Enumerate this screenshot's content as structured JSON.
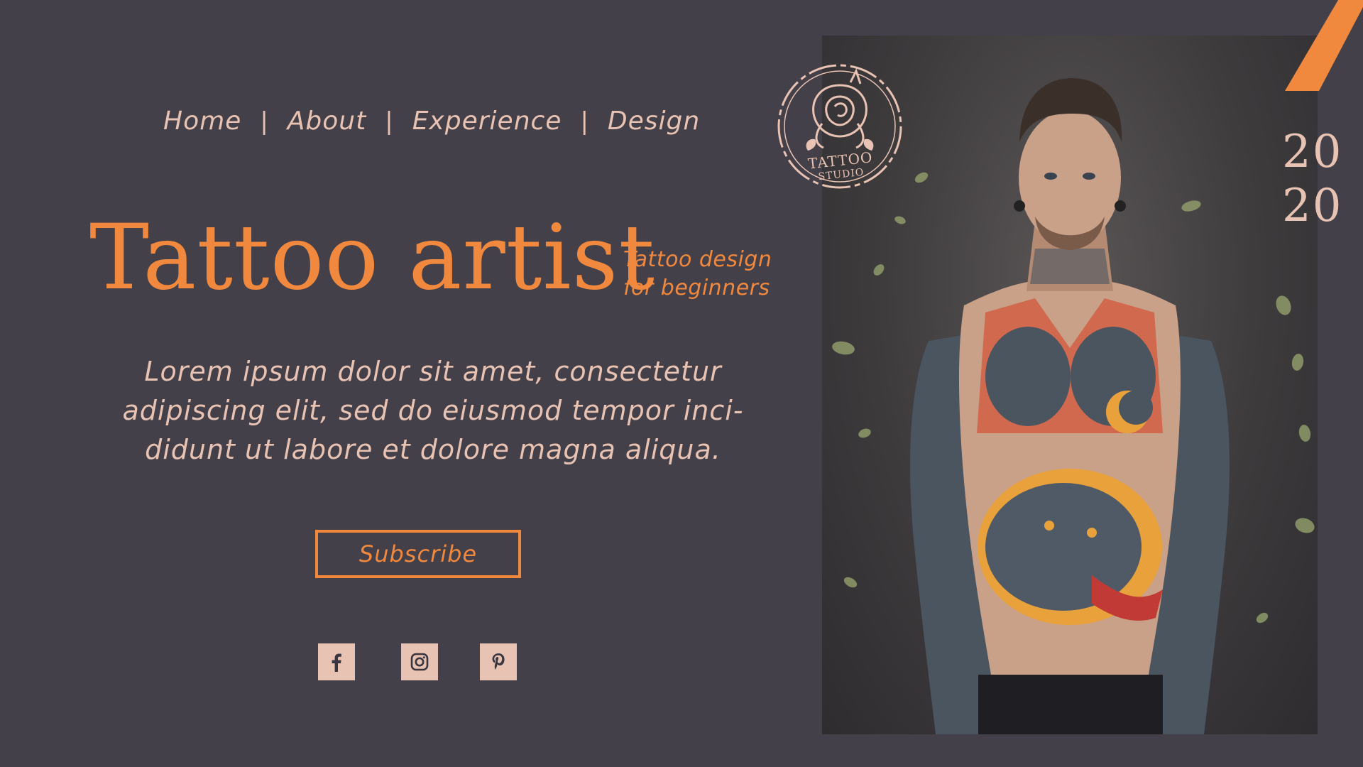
{
  "nav": {
    "items": [
      {
        "label": "Home"
      },
      {
        "label": "About"
      },
      {
        "label": "Experience"
      },
      {
        "label": "Design"
      }
    ],
    "separator": "|"
  },
  "hero": {
    "title": "Tattoo artist",
    "subtitle_line1": "Tattoo design",
    "subtitle_line2": "for beginners",
    "body_lines": [
      "Lorem ipsum dolor sit amet, consectetur",
      "adipiscing elit, sed do eiusmod tempor inci-",
      "didunt ut labore et dolore magna aliqua."
    ],
    "cta_label": "Subscribe"
  },
  "social": [
    {
      "name": "facebook-icon",
      "glyph": "f"
    },
    {
      "name": "instagram-icon"
    },
    {
      "name": "pinterest-icon",
      "glyph": "P"
    }
  ],
  "logo": {
    "line1": "TATTOO",
    "line2": "STUDIO"
  },
  "year": {
    "line1": "20",
    "line2": "20"
  },
  "colors": {
    "background": "#444049",
    "accent": "#f0883e",
    "text": "#e8c3b3"
  }
}
